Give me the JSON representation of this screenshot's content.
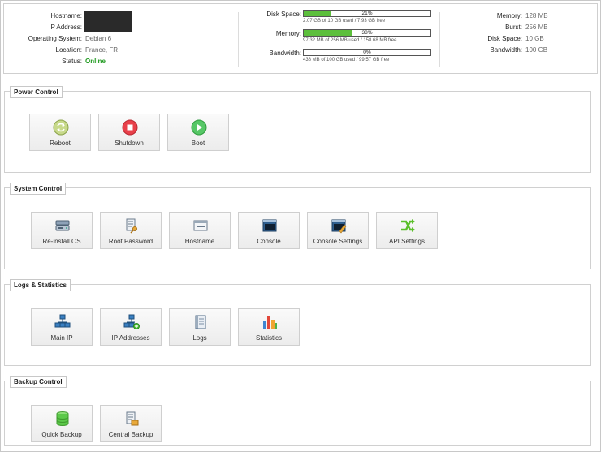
{
  "server": {
    "hostname_label": "Hostname:",
    "ip_label": "IP Address:",
    "os_label": "Operating System:",
    "os_value": "Debian 6",
    "location_label": "Location:",
    "location_value": "France, FR",
    "status_label": "Status:",
    "status_value": "Online"
  },
  "usage": {
    "disk_label": "Disk Space:",
    "disk_percent_text": "21%",
    "disk_percent": 21,
    "disk_detail": "2.07 GB of 10 GB used / 7.93 GB free",
    "memory_label": "Memory:",
    "memory_percent_text": "38%",
    "memory_percent": 38,
    "memory_detail": "97.32 MB of 256 MB used / 158.68 MB free",
    "bandwidth_label": "Bandwidth:",
    "bandwidth_percent_text": "0%",
    "bandwidth_percent": 0,
    "bandwidth_detail": "438 MB of 100 GB used / 99.57 GB free"
  },
  "limits": {
    "memory_label": "Memory:",
    "memory_value": "128 MB",
    "burst_label": "Burst:",
    "burst_value": "256 MB",
    "disk_label": "Disk Space:",
    "disk_value": "10 GB",
    "bandwidth_label": "Bandwidth:",
    "bandwidth_value": "100 GB"
  },
  "sections": {
    "power": {
      "title": "Power Control",
      "buttons": [
        "Reboot",
        "Shutdown",
        "Boot"
      ]
    },
    "system": {
      "title": "System Control",
      "buttons": [
        "Re-install OS",
        "Root Password",
        "Hostname",
        "Console",
        "Console Settings",
        "API Settings"
      ]
    },
    "logs": {
      "title": "Logs & Statistics",
      "buttons": [
        "Main IP",
        "IP Addresses",
        "Logs",
        "Statistics"
      ]
    },
    "backup": {
      "title": "Backup Control",
      "buttons": [
        "Quick Backup",
        "Central Backup"
      ]
    }
  },
  "colors": {
    "progress_fill": "#5cbf3c",
    "status_online": "#1f9a1f"
  }
}
